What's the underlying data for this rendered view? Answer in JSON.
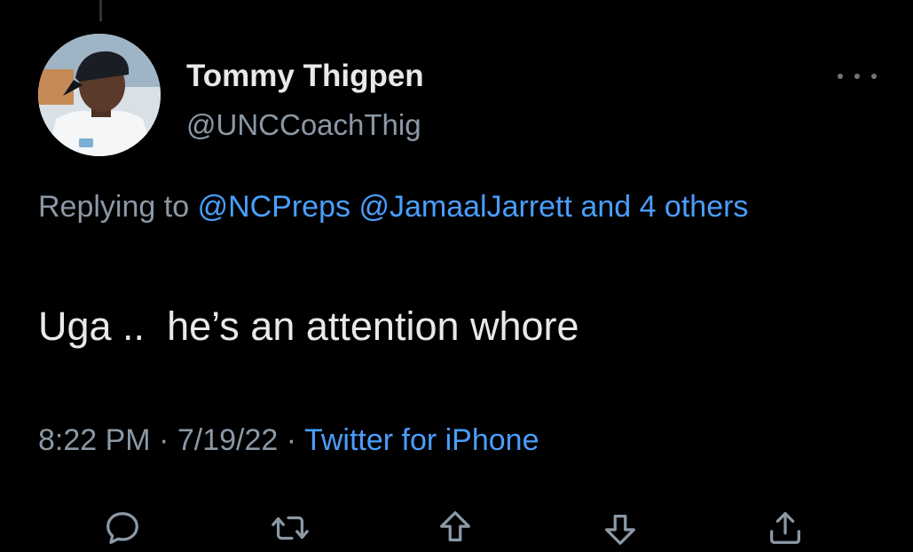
{
  "author": {
    "name": "Tommy Thigpen",
    "handle": "@UNCCoachThig"
  },
  "reply_context": {
    "prefix": "Replying to",
    "mentions": [
      "@NCPreps",
      "@JamaalJarrett"
    ],
    "others": "and 4 others"
  },
  "tweet": {
    "text": "Uga ..  he’s an attention whore"
  },
  "meta": {
    "time": "8:22 PM",
    "separator": "·",
    "date": "7/19/22",
    "source": "Twitter for iPhone"
  },
  "actions": {
    "icons": [
      "reply-icon",
      "retweet-icon",
      "upvote-icon",
      "downvote-icon",
      "share-icon"
    ]
  },
  "colors": {
    "background": "#000000",
    "text_primary": "#e7e9ea",
    "text_secondary": "#8b98a5",
    "link": "#4a9eff",
    "icon": "#8b98a5"
  }
}
